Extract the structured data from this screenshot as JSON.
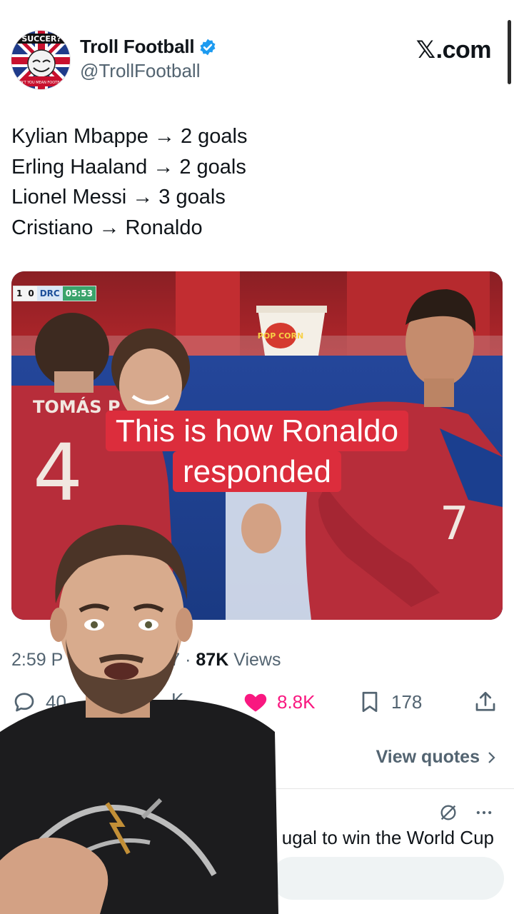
{
  "author": {
    "name": "Troll Football",
    "handle": "@TrollFootball",
    "avatar_text": "SUCCER?",
    "avatar_subtext": "DON'T YOU MEAN FOOTBALL?"
  },
  "site_label": ".com",
  "site_glyph": "𝕏",
  "tweet_lines": [
    "Kylian Mbappe → 2 goals",
    "Erling Haaland → 2 goals",
    "Lionel Messi → 3 goals",
    "Cristiano → Ronaldo"
  ],
  "media": {
    "scorebug": {
      "score_home": "1",
      "score_away": "0",
      "team": "DRC",
      "clock": "05:53"
    },
    "player_left_name": "TOMÁS P",
    "player_left_number": "4",
    "player_right_number": "7",
    "popcorn_text": "POP CORN"
  },
  "caption": {
    "line1": "This is how Ronaldo",
    "line2": "responded"
  },
  "meta": {
    "time_visible": "2:59 P",
    "suffix_visible": "7 · ",
    "views_count": "87K",
    "views_label": " Views"
  },
  "actions": {
    "replies_visible": "40",
    "reposts_visible": "K",
    "likes": "8.8K",
    "bookmarks": "178"
  },
  "view_quotes_label": "View quotes",
  "reply_preview_text": "ugal to win the World Cup",
  "colors": {
    "like": "#f91880",
    "verified": "#1d9bf0",
    "caption_bg": "#dc2d3c",
    "muted": "#536471"
  }
}
